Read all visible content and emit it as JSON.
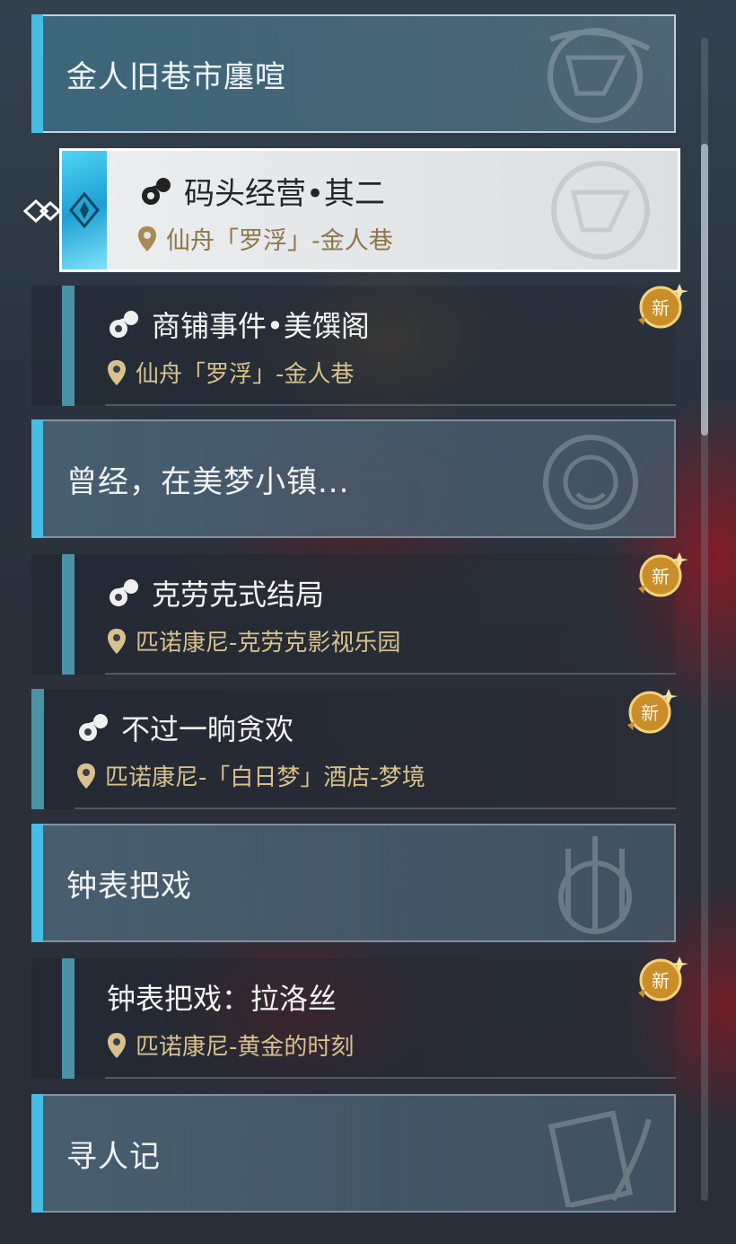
{
  "colors": {
    "accent": "#46bde2",
    "quest_bar": "#4a92a5",
    "location_text": "#d8c18d",
    "badge_gold": "#e6b94a"
  },
  "groups": [
    {
      "title": "金人旧巷市廛喧",
      "quests": [
        {
          "name": "码头经营•其二",
          "location": "仙舟「罗浮」-金人巷",
          "selected": true,
          "icon": "quest-type-icon",
          "is_new": false
        },
        {
          "name": "商铺事件•美馔阁",
          "location": "仙舟「罗浮」-金人巷",
          "selected": false,
          "icon": "quest-type-icon",
          "is_new": true,
          "badge": "新"
        }
      ]
    },
    {
      "title": "曾经，在美梦小镇...",
      "quests": [
        {
          "name": "克劳克式结局",
          "location": "匹诺康尼-克劳克影视乐园",
          "icon": "quest-type-icon",
          "is_new": true,
          "badge": "新"
        },
        {
          "name": "不过一晌贪欢",
          "location": "匹诺康尼-「白日梦」酒店-梦境",
          "icon": "quest-type-icon",
          "is_new": true,
          "badge": "新"
        }
      ]
    },
    {
      "title": "钟表把戏",
      "quests": [
        {
          "name": "钟表把戏：拉洛丝",
          "location": "匹诺康尼-黄金的时刻",
          "is_new": true,
          "badge": "新"
        }
      ]
    },
    {
      "title": "寻人记",
      "quests": []
    }
  ]
}
